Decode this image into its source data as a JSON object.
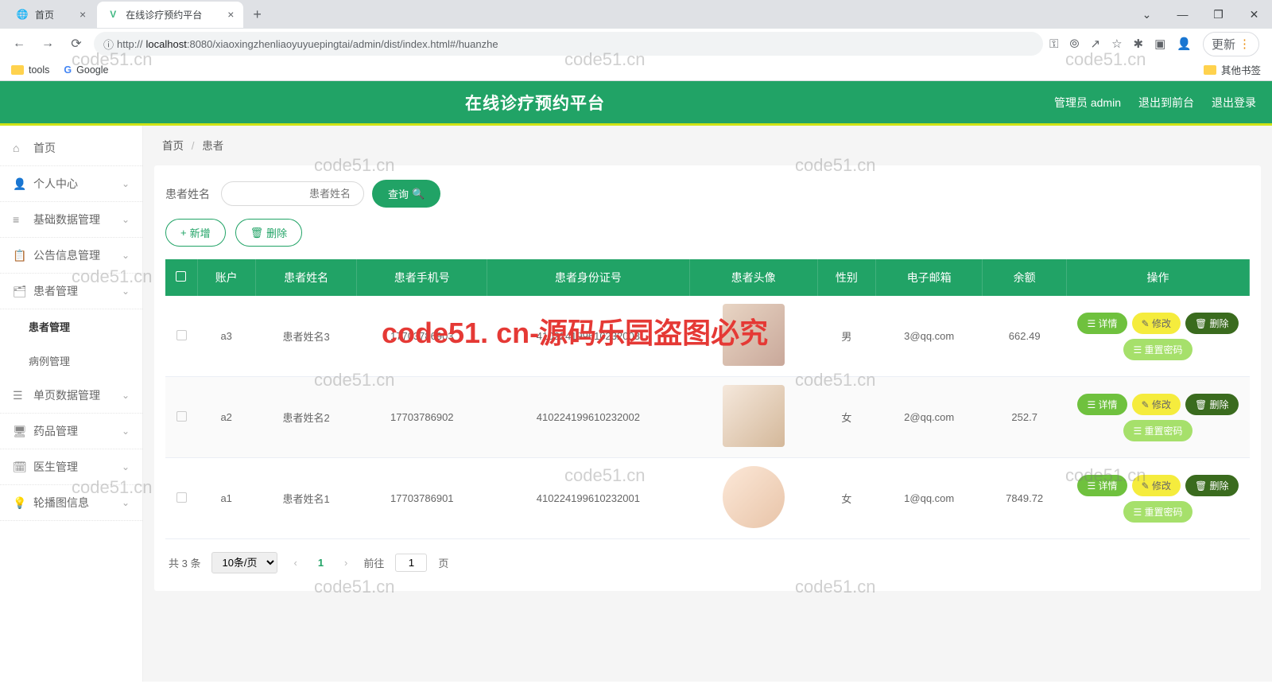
{
  "browser": {
    "tabs": [
      {
        "fav": "🌐",
        "title": "首页"
      },
      {
        "fav": "V",
        "title": "在线诊疗预约平台"
      }
    ],
    "url_host": "localhost",
    "url_port": ":8080",
    "url_path": "/xiaoxingzhenliaoyuyuepingtai/admin/dist/index.html#/huanzhe",
    "update": "更新",
    "bookmarks": {
      "tools": "tools",
      "google": "Google",
      "other": "其他书签"
    }
  },
  "header": {
    "title": "在线诊疗预约平台",
    "admin": "管理员 admin",
    "back": "退出到前台",
    "logout": "退出登录"
  },
  "sidebar": {
    "items": [
      {
        "icon": "⌂",
        "label": "首页"
      },
      {
        "icon": "👤",
        "label": "个人中心",
        "chev": true
      },
      {
        "icon": "≡",
        "label": "基础数据管理",
        "chev": true
      },
      {
        "icon": "📋",
        "label": "公告信息管理",
        "chev": true
      },
      {
        "icon": "🗂",
        "label": "患者管理",
        "chev": true
      },
      {
        "icon": "☰",
        "label": "单页数据管理",
        "chev": true
      },
      {
        "icon": "🖥",
        "label": "药品管理",
        "chev": true
      },
      {
        "icon": "🗓",
        "label": "医生管理",
        "chev": true
      },
      {
        "icon": "💡",
        "label": "轮播图信息",
        "chev": true
      }
    ],
    "subs": {
      "patient": "患者管理",
      "case": "病例管理"
    }
  },
  "breadcrumb": {
    "home": "首页",
    "current": "患者"
  },
  "search": {
    "label": "患者姓名",
    "placeholder": "患者姓名",
    "query": "查询"
  },
  "actions": {
    "add": "新增",
    "delete": "删除"
  },
  "table": {
    "headers": [
      "账户",
      "患者姓名",
      "患者手机号",
      "患者身份证号",
      "患者头像",
      "性别",
      "电子邮箱",
      "余额",
      "操作"
    ],
    "rows": [
      {
        "acct": "a3",
        "name": "患者姓名3",
        "phone": "17703786903",
        "idcard": "410224199610232003",
        "gender": "男",
        "email": "3@qq.com",
        "balance": "662.49"
      },
      {
        "acct": "a2",
        "name": "患者姓名2",
        "phone": "17703786902",
        "idcard": "410224199610232002",
        "gender": "女",
        "email": "2@qq.com",
        "balance": "252.7"
      },
      {
        "acct": "a1",
        "name": "患者姓名1",
        "phone": "17703786901",
        "idcard": "410224199610232001",
        "gender": "女",
        "email": "1@qq.com",
        "balance": "7849.72"
      }
    ],
    "ops": {
      "detail": "详情",
      "edit": "修改",
      "delete": "删除",
      "reset": "重置密码"
    }
  },
  "pagination": {
    "total": "共 3 条",
    "pagesize": "10条/页",
    "page": "1",
    "goto": "前往",
    "page_unit": "页"
  },
  "watermarks": {
    "text": "code51.cn",
    "red": "code51. cn-源码乐园盗图必究"
  }
}
